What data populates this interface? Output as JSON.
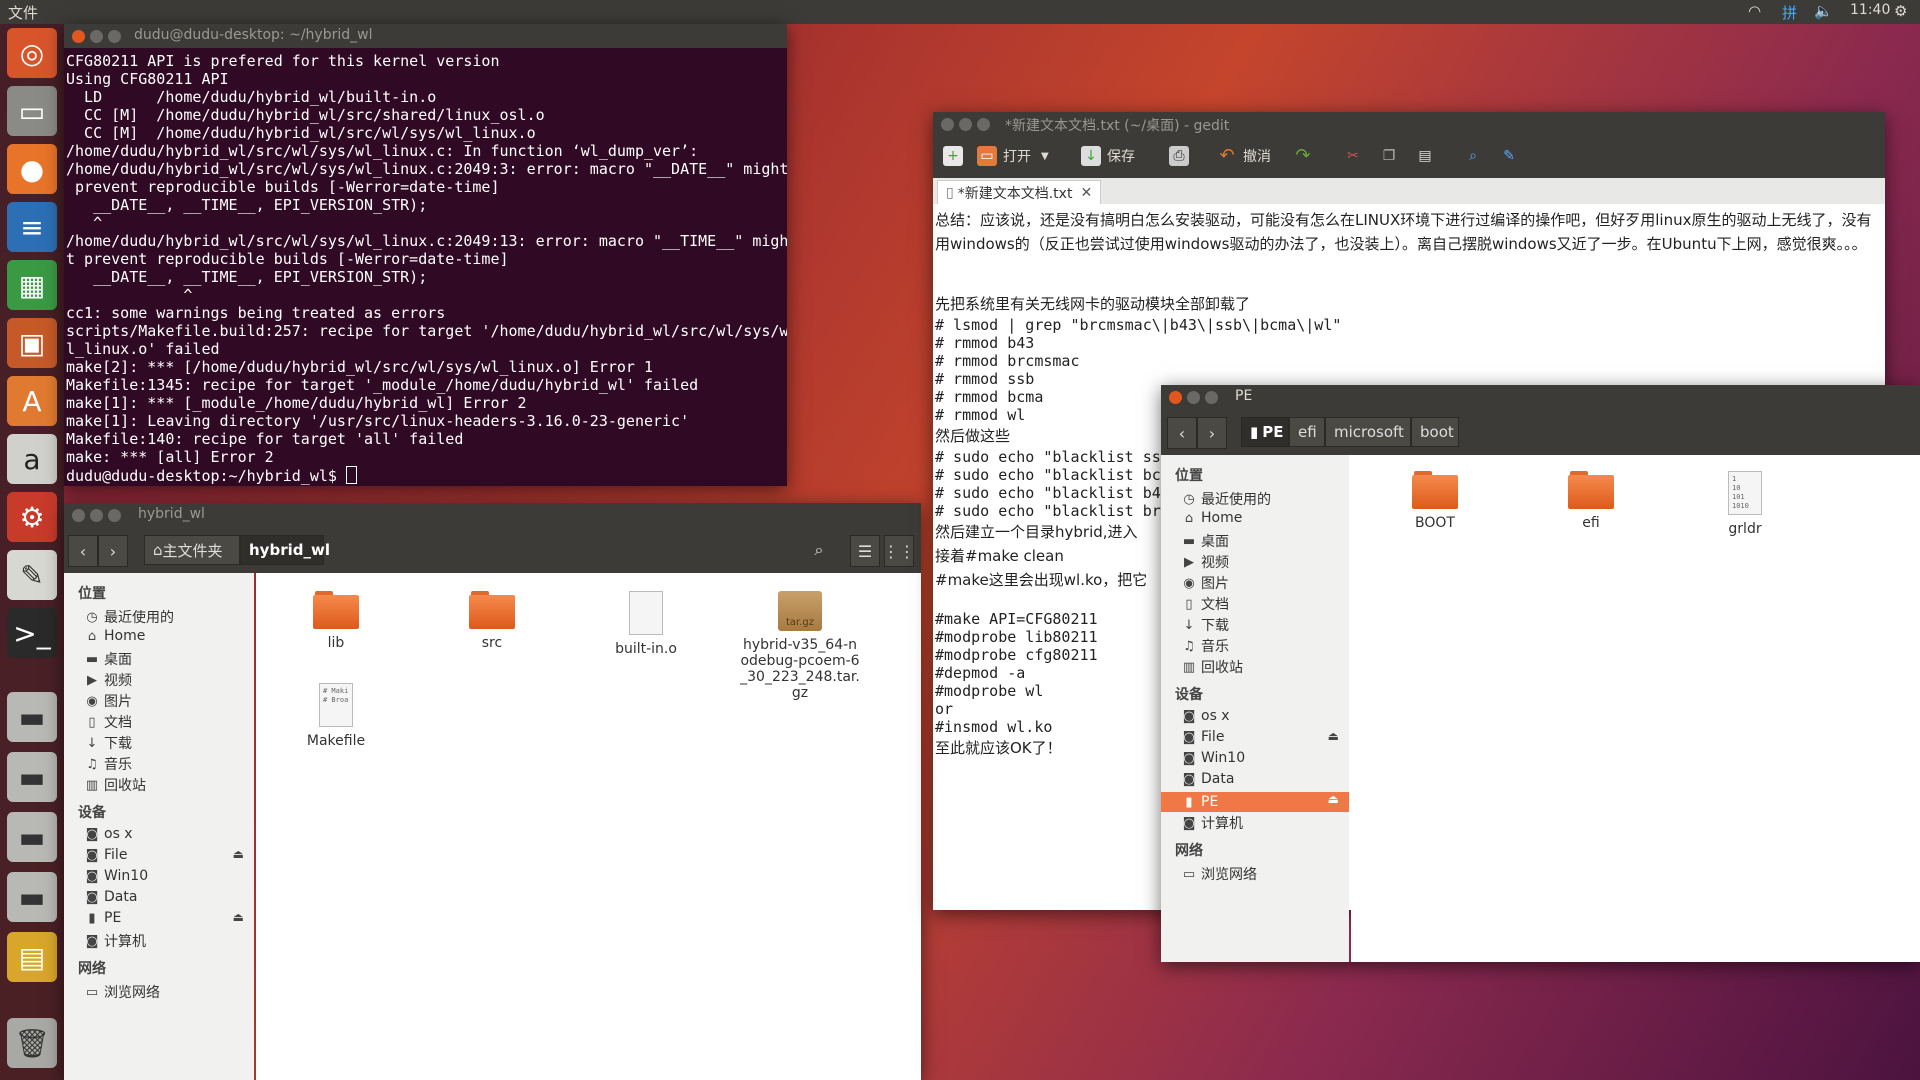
{
  "top_panel": {
    "menu_label": "文件",
    "time": "11:40",
    "icons": [
      "wifi-icon",
      "input-method-icon",
      "volume-icon",
      "settings-icon"
    ],
    "input_method_glyph": "拼"
  },
  "launcher": {
    "items": [
      "ubuntu-dash-icon",
      "files-icon",
      "firefox-icon",
      "writer-icon",
      "calc-icon",
      "impress-icon",
      "software-center-icon",
      "amazon-icon",
      "system-settings-icon",
      "gedit-icon",
      "terminal-icon",
      "drive-icon",
      "drive-icon",
      "drive-icon",
      "drive-icon",
      "workspace-icon",
      "trash-icon"
    ]
  },
  "terminal": {
    "title": "dudu@dudu-desktop: ~/hybrid_wl",
    "lines": [
      "CFG80211 API is prefered for this kernel version",
      "Using CFG80211 API",
      "  LD      /home/dudu/hybrid_wl/built-in.o",
      "  CC [M]  /home/dudu/hybrid_wl/src/shared/linux_osl.o",
      "  CC [M]  /home/dudu/hybrid_wl/src/wl/sys/wl_linux.o",
      "/home/dudu/hybrid_wl/src/wl/sys/wl_linux.c: In function ‘wl_dump_ver’:",
      "/home/dudu/hybrid_wl/src/wl/sys/wl_linux.c:2049:3: error: macro \"__DATE__\" might",
      " prevent reproducible builds [-Werror=date-time]",
      "   __DATE__, __TIME__, EPI_VERSION_STR);",
      "   ^",
      "/home/dudu/hybrid_wl/src/wl/sys/wl_linux.c:2049:13: error: macro \"__TIME__\" migh",
      "t prevent reproducible builds [-Werror=date-time]",
      "   __DATE__, __TIME__, EPI_VERSION_STR);",
      "             ^",
      "cc1: some warnings being treated as errors",
      "scripts/Makefile.build:257: recipe for target '/home/dudu/hybrid_wl/src/wl/sys/w",
      "l_linux.o' failed",
      "make[2]: *** [/home/dudu/hybrid_wl/src/wl/sys/wl_linux.o] Error 1",
      "Makefile:1345: recipe for target '_module_/home/dudu/hybrid_wl' failed",
      "make[1]: *** [_module_/home/dudu/hybrid_wl] Error 2",
      "make[1]: Leaving directory '/usr/src/linux-headers-3.16.0-23-generic'",
      "Makefile:140: recipe for target 'all' failed",
      "make: *** [all] Error 2"
    ],
    "prompt": "dudu@dudu-desktop:~/hybrid_wl$ "
  },
  "files_hybrid": {
    "title": "hybrid_wl",
    "breadcrumbs": [
      "主文件夹",
      "hybrid_wl"
    ],
    "sidebar": {
      "places_header": "位置",
      "places": [
        {
          "icon": "recent-icon",
          "label": "最近使用的"
        },
        {
          "icon": "home-icon",
          "label": "Home"
        },
        {
          "icon": "desktop-icon",
          "label": "桌面"
        },
        {
          "icon": "video-icon",
          "label": "视频"
        },
        {
          "icon": "pictures-icon",
          "label": "图片"
        },
        {
          "icon": "documents-icon",
          "label": "文档"
        },
        {
          "icon": "downloads-icon",
          "label": "下载"
        },
        {
          "icon": "music-icon",
          "label": "音乐"
        },
        {
          "icon": "trash-icon",
          "label": "回收站"
        }
      ],
      "devices_header": "设备",
      "devices": [
        {
          "label": "os x",
          "eject": false
        },
        {
          "label": "File",
          "eject": true
        },
        {
          "label": "Win10",
          "eject": false
        },
        {
          "label": "Data",
          "eject": false
        },
        {
          "label": "PE",
          "eject": true
        },
        {
          "label": "计算机",
          "eject": false
        }
      ],
      "network_header": "网络",
      "network": [
        {
          "label": "浏览网络"
        }
      ]
    },
    "files": [
      {
        "name": "lib",
        "type": "folder"
      },
      {
        "name": "src",
        "type": "folder"
      },
      {
        "name": "built-in.o",
        "type": "binary"
      },
      {
        "name": "hybrid-v35_64-nodebug-pcoem-6_30_223_248.tar.gz",
        "type": "archive",
        "badge": "tar.gz"
      },
      {
        "name": "Makefile",
        "type": "text",
        "preview": "# Maki\n# Broa"
      }
    ]
  },
  "gedit": {
    "title": "*新建文本文档.txt (~/桌面) - gedit",
    "toolbar": {
      "open": "打开",
      "save": "保存",
      "undo": "撤消"
    },
    "tab_label": "*新建文本文档.txt",
    "text_lines": [
      "总结：应该说，还是没有搞明白怎么安装驱动，可能没有怎么在LINUX环境下进行过编译的操作吧，但好歹用linux原生的驱动上无线了，没有用windows的（反正也尝试过使用windows驱动的办法了，也没装上）。离自己摆脱windows又近了一步。在Ubuntu下上网，感觉很爽。。。",
      "",
      "",
      "先把系统里有关无线网卡的驱动模块全部卸载了",
      "# lsmod | grep \"brcmsmac\\|b43\\|ssb\\|bcma\\|wl\"",
      "# rmmod b43",
      "# rmmod brcmsmac",
      "# rmmod ssb",
      "# rmmod bcma",
      "# rmmod wl",
      "然后做这些",
      "# sudo echo \"blacklist ssb",
      "# sudo echo \"blacklist bc",
      "# sudo echo \"blacklist b4",
      "# sudo echo \"blacklist br",
      "然后建立一个目录hybrid,进入",
      "接着#make clean",
      "#make这里会出现wl.ko，把它",
      "",
      "#make API=CFG80211",
      "#modprobe lib80211",
      "#modprobe cfg80211",
      "#depmod -a",
      "#modprobe wl",
      "or",
      "#insmod wl.ko",
      "至此就应该OK了！"
    ]
  },
  "files_pe": {
    "title": "PE",
    "breadcrumbs": [
      "PE",
      "efi",
      "microsoft",
      "boot"
    ],
    "sidebar": {
      "places_header": "位置",
      "places": [
        {
          "icon": "recent-icon",
          "label": "最近使用的"
        },
        {
          "icon": "home-icon",
          "label": "Home"
        },
        {
          "icon": "desktop-icon",
          "label": "桌面"
        },
        {
          "icon": "video-icon",
          "label": "视频"
        },
        {
          "icon": "pictures-icon",
          "label": "图片"
        },
        {
          "icon": "documents-icon",
          "label": "文档"
        },
        {
          "icon": "downloads-icon",
          "label": "下载"
        },
        {
          "icon": "music-icon",
          "label": "音乐"
        },
        {
          "icon": "trash-icon",
          "label": "回收站"
        }
      ],
      "devices_header": "设备",
      "devices": [
        {
          "label": "os x",
          "eject": false
        },
        {
          "label": "File",
          "eject": true
        },
        {
          "label": "Win10",
          "eject": false
        },
        {
          "label": "Data",
          "eject": false
        },
        {
          "label": "PE",
          "eject": true,
          "selected": true
        },
        {
          "label": "计算机",
          "eject": false
        }
      ],
      "network_header": "网络",
      "network": [
        {
          "label": "浏览网络"
        }
      ]
    },
    "files": [
      {
        "name": "BOOT",
        "type": "folder"
      },
      {
        "name": "efi",
        "type": "folder"
      },
      {
        "name": "grldr",
        "type": "binary",
        "preview": "1\n10\n101\n1010"
      }
    ]
  },
  "colors": {
    "accent": "#f07746",
    "terminal_bg": "#300a24",
    "panel": "#3c3b37",
    "selected": "#f07746"
  }
}
